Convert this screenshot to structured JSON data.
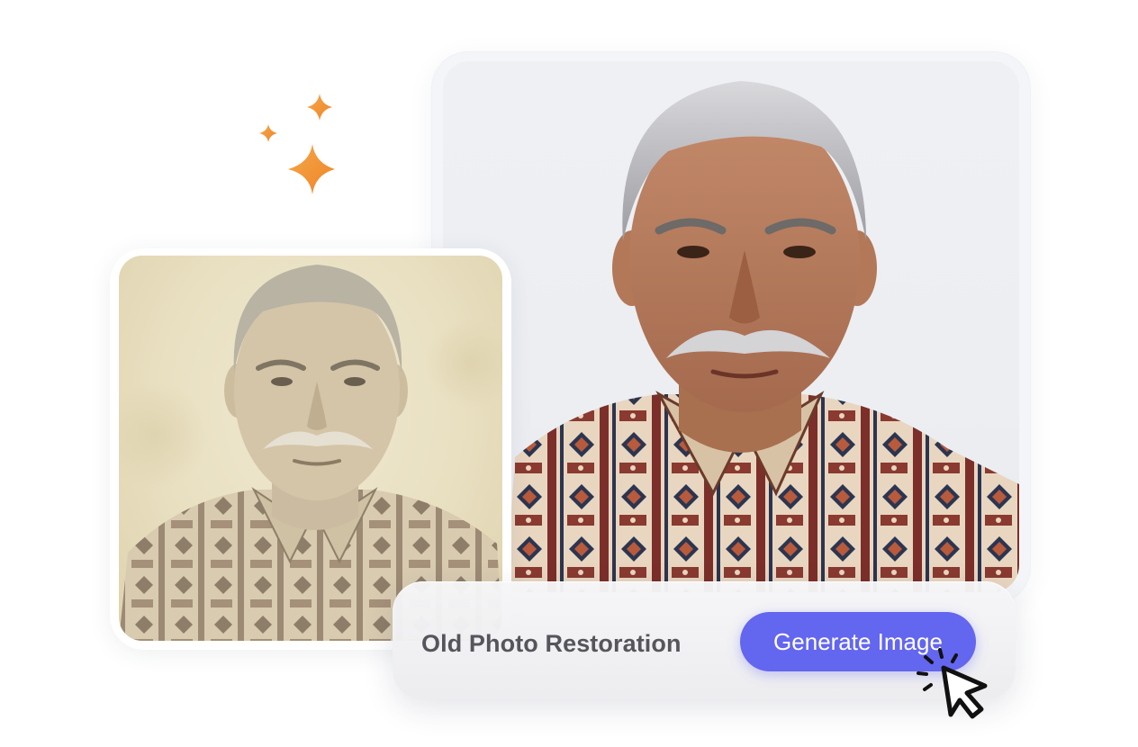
{
  "action_bar": {
    "title": "Old Photo Restoration",
    "generate_button_label": "Generate Image"
  },
  "images": {
    "original": "old-faded-portrait",
    "restored": "restored-color-portrait"
  },
  "icons": [
    "sparkle-icon",
    "click-cursor-icon"
  ],
  "colors": {
    "accent": "#6366EE",
    "sparkle": "#F2922E",
    "label_text": "#55555B",
    "button_text": "#FFFFFF"
  }
}
